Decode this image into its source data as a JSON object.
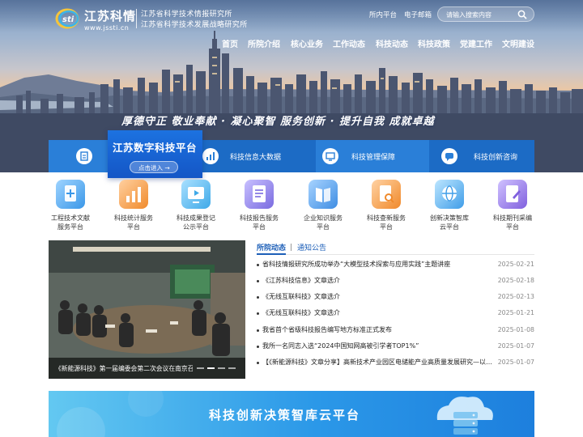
{
  "header": {
    "logo_title": "江苏科情",
    "logo_url": "www.jssti.cn",
    "org_name_1": "江苏省科学技术情报研究所",
    "org_name_2": "江苏省科学技术发展战略研究所",
    "links": [
      "所内平台",
      "电子邮箱"
    ],
    "search_placeholder": "请输入搜索内容"
  },
  "nav": [
    "首页",
    "所院介绍",
    "核心业务",
    "工作动态",
    "科技动态",
    "科技政策",
    "党建工作",
    "文明建设"
  ],
  "hero": {
    "slogan": "厚德守正  敬业奉献 · 凝心聚智  服务创新 · 提升自我  成就卓越"
  },
  "featured_platform": {
    "title": "江苏数字科技平台",
    "button": "点击进入 →"
  },
  "service_bar": [
    {
      "label": "科技信息大数据",
      "icon": "chart-icon"
    },
    {
      "label": "科技管理保障",
      "icon": "monitor-icon"
    },
    {
      "label": "科技创新咨询",
      "icon": "chat-icon"
    }
  ],
  "platforms": [
    {
      "line1": "工程技术文献",
      "line2": "服务平台",
      "icon": "document-plus-icon",
      "color": "#3a97e8"
    },
    {
      "line1": "科技统计服务",
      "line2": "平台",
      "icon": "stats-icon",
      "color": "#f08a2c"
    },
    {
      "line1": "科技成果登记",
      "line2": "公示平台",
      "icon": "play-screen-icon",
      "color": "#3fa9e8"
    },
    {
      "line1": "科技报告服务",
      "line2": "平台",
      "icon": "report-icon",
      "color": "#7a6be0"
    },
    {
      "line1": "企业知识服务",
      "line2": "平台",
      "icon": "book-icon",
      "color": "#3f8de3"
    },
    {
      "line1": "科技查新服务",
      "line2": "平台",
      "icon": "search-doc-icon",
      "color": "#f0892a"
    },
    {
      "line1": "创新决策智库",
      "line2": "云平台",
      "icon": "globe-icon",
      "color": "#3f9de8"
    },
    {
      "line1": "科技期刊采编",
      "line2": "平台",
      "icon": "edit-doc-icon",
      "color": "#8060de"
    }
  ],
  "photo_news": {
    "caption": "《新能源科技》第一届编委会第二次会议在南京召开",
    "slides": 4,
    "active_slide": 1
  },
  "news": {
    "tab_active": "所院动态",
    "tab_inactive": "通知公告",
    "items": [
      {
        "title": "省科技情报研究所成功举办“大模型技术探索与应用实践”主题讲座",
        "date": "2025-02-21"
      },
      {
        "title": "《江苏科技信息》文章选介",
        "date": "2025-02-18"
      },
      {
        "title": "《无线互联科技》文章选介",
        "date": "2025-02-13"
      },
      {
        "title": "《无线互联科技》文章选介",
        "date": "2025-01-21"
      },
      {
        "title": "我省首个省级科技报告编写地方标准正式发布",
        "date": "2025-01-08"
      },
      {
        "title": "我所一名同志入选“2024中国知网高被引学者TOP1%”",
        "date": "2025-01-07"
      },
      {
        "title": "【《新能源科技》文章分享】高新技术产业园区电储能产业高质量发展研究—以…",
        "date": "2025-01-07"
      }
    ]
  },
  "banner": {
    "title": "科技创新决策智库云平台"
  },
  "colors": {
    "primary_blue": "#2a7fd8",
    "nav_text": "#ffffff",
    "link_blue": "#1d5fb8"
  }
}
